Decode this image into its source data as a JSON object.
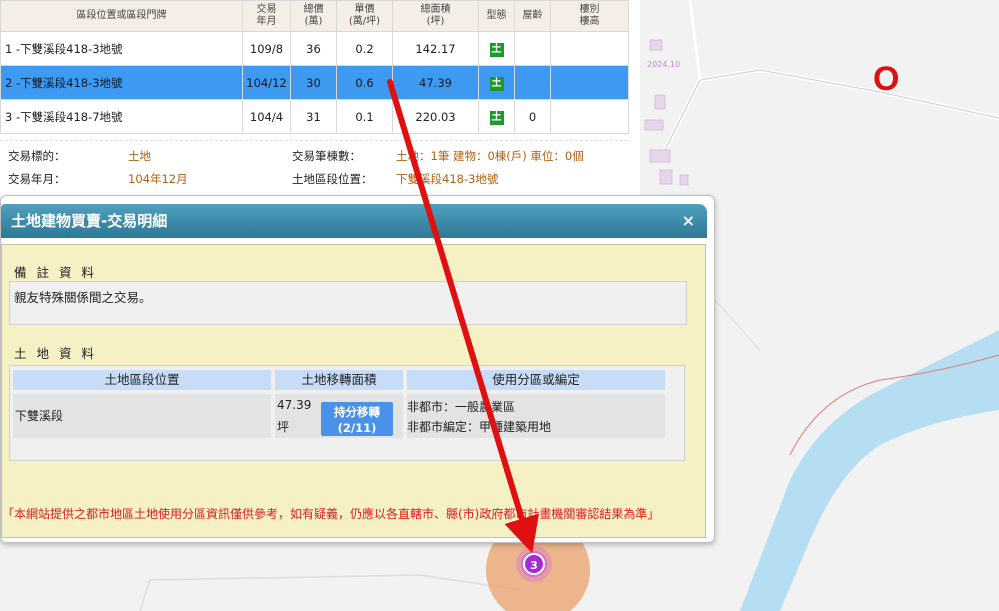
{
  "table": {
    "headers": [
      "區段位置或區段門牌",
      "交易\n年月",
      "總價\n(萬)",
      "單價\n(萬/坪)",
      "總面積\n(坪)",
      "型態",
      "屋齡",
      "樓別\n樓高"
    ],
    "rows": [
      {
        "loc": "1 -下雙溪段418-3地號",
        "date": "109/8",
        "total": "36",
        "unit": "0.2",
        "area": "142.17",
        "type": "土",
        "age": "",
        "floor": ""
      },
      {
        "loc": "2 -下雙溪段418-3地號",
        "date": "104/12",
        "total": "30",
        "unit": "0.6",
        "area": "47.39",
        "type": "土",
        "age": "",
        "floor": ""
      },
      {
        "loc": "3 -下雙溪段418-7地號",
        "date": "104/4",
        "total": "31",
        "unit": "0.1",
        "area": "220.03",
        "type": "土",
        "age": "0",
        "floor": ""
      }
    ]
  },
  "info": {
    "subject_label": "交易標的：",
    "subject_value": "土地",
    "count_label": "交易筆棟數：",
    "count_value": "土地：1筆 建物：0棟(戶) 車位：0個",
    "date_label": "交易年月：",
    "date_value": "104年12月",
    "location_label": "土地區段位置：",
    "location_value": "下雙溪段418-3地號"
  },
  "dialog": {
    "title": "土地建物買賣-交易明細",
    "close": "×",
    "remarks_title": "備 註 資 料",
    "remarks_text": "親友特殊關係間之交易。",
    "land_title": "土 地 資 料",
    "land_headers": [
      "土地區段位置",
      "土地移轉面積",
      "使用分區或編定"
    ],
    "land_row": {
      "location": "下雙溪段",
      "area_value": "47.39",
      "area_unit": "坪",
      "status_line1": "持分移轉",
      "status_line2": "(2/11)",
      "zoning_line1": "非都市：一般農業區",
      "zoning_line2": "非都市編定：甲種建築用地"
    },
    "disclaimer": "「本網站提供之都市地區土地使用分區資訊僅供參考，如有疑義，仍應以各直轄市、縣(市)政府都市計畫機關審認結果為準」"
  },
  "map": {
    "cluster_count": "3",
    "annotation_mark": "O",
    "faint_label": "2024.10"
  },
  "colors": {
    "selected_row": "#3d9af0",
    "dialog_header": "#2e7895",
    "dialog_body": "#f6f1c4",
    "land_badge": "#1f9a2a",
    "river": "#b5def2",
    "arrow": "#e01010",
    "cluster": "#a52bd6",
    "cluster_halo": "#eaa06a"
  }
}
